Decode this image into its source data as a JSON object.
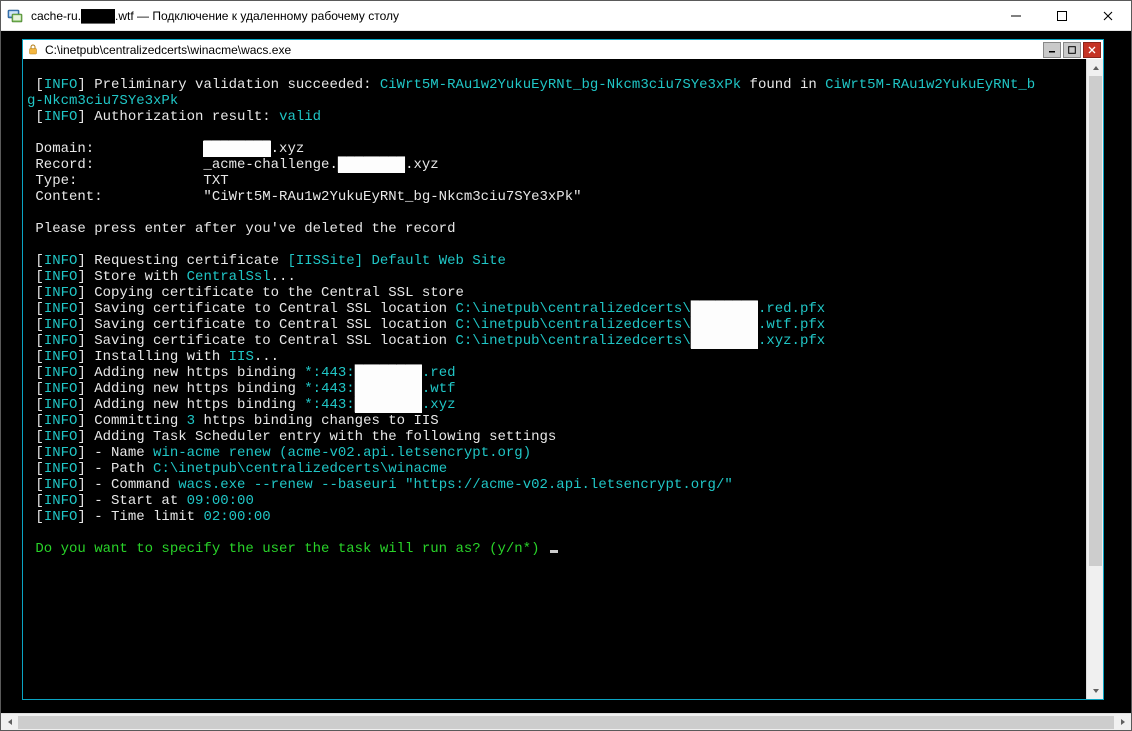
{
  "outer": {
    "title": "cache-ru.████.wtf — Подключение к удаленному рабочему столу",
    "min_tip": "Minimize",
    "max_tip": "Maximize",
    "close_tip": "Close"
  },
  "console": {
    "title": "C:\\inetpub\\centralizedcerts\\winacme\\wacs.exe"
  },
  "redacted": "████████",
  "lines": {
    "l01a": "[",
    "l01b": "INFO",
    "l01c": "] Preliminary validation succeeded: ",
    "l01d": "CiWrt5M-RAu1w2YukuEyRNt_bg-Nkcm3ciu7SYe3xPk",
    "l01e": " found in ",
    "l01f": "CiWrt5M-RAu1w2YukuEyRNt_b",
    "l02": "g-Nkcm3ciu7SYe3xPk",
    "l03a": "[",
    "l03b": "INFO",
    "l03c": "] Authorization result: ",
    "l03d": "valid",
    "l05a": " Domain:             ",
    "l05b": ".xyz",
    "l06a": " Record:             _acme-challenge.",
    "l06b": ".xyz",
    "l07": " Type:               TXT",
    "l08": " Content:            \"CiWrt5M-RAu1w2YukuEyRNt_bg-Nkcm3ciu7SYe3xPk\"",
    "l10": " Please press enter after you've deleted the record",
    "l12a": "[",
    "l12b": "INFO",
    "l12c": "] Requesting certificate ",
    "l12d": "[IISSite] Default Web Site",
    "l13a": "[",
    "l13b": "INFO",
    "l13c": "] Store with ",
    "l13d": "CentralSsl",
    "l13e": "...",
    "l14a": "[",
    "l14b": "INFO",
    "l14c": "] Copying certificate to the Central SSL store",
    "l15a": "[",
    "l15b": "INFO",
    "l15c": "] Saving certificate to Central SSL location ",
    "l15d": "C:\\inetpub\\centralizedcerts\\",
    "l15e": ".red.pfx",
    "l16a": "[",
    "l16b": "INFO",
    "l16c": "] Saving certificate to Central SSL location ",
    "l16d": "C:\\inetpub\\centralizedcerts\\",
    "l16e": ".wtf.pfx",
    "l17a": "[",
    "l17b": "INFO",
    "l17c": "] Saving certificate to Central SSL location ",
    "l17d": "C:\\inetpub\\centralizedcerts\\",
    "l17e": ".xyz.pfx",
    "l18a": "[",
    "l18b": "INFO",
    "l18c": "] Installing with ",
    "l18d": "IIS",
    "l18e": "...",
    "l19a": "[",
    "l19b": "INFO",
    "l19c": "] Adding new https binding ",
    "l19d": "*:443:",
    "l19e": ".red",
    "l20a": "[",
    "l20b": "INFO",
    "l20c": "] Adding new https binding ",
    "l20d": "*:443:",
    "l20e": ".wtf",
    "l21a": "[",
    "l21b": "INFO",
    "l21c": "] Adding new https binding ",
    "l21d": "*:443:",
    "l21e": ".xyz",
    "l22a": "[",
    "l22b": "INFO",
    "l22c": "] Committing ",
    "l22d": "3",
    "l22e": " https binding changes to IIS",
    "l23a": "[",
    "l23b": "INFO",
    "l23c": "] Adding Task Scheduler entry with the following settings",
    "l24a": "[",
    "l24b": "INFO",
    "l24c": "] - Name ",
    "l24d": "win-acme renew (acme-v02.api.letsencrypt.org)",
    "l25a": "[",
    "l25b": "INFO",
    "l25c": "] - Path ",
    "l25d": "C:\\inetpub\\centralizedcerts\\winacme",
    "l26a": "[",
    "l26b": "INFO",
    "l26c": "] - Command ",
    "l26d": "wacs.exe --renew --baseuri \"https://acme-v02.api.letsencrypt.org/\"",
    "l27a": "[",
    "l27b": "INFO",
    "l27c": "] - Start at ",
    "l27d": "09:00:00",
    "l28a": "[",
    "l28b": "INFO",
    "l28c": "] - Time limit ",
    "l28d": "02:00:00",
    "prompt": " Do you want to specify the user the task will run as? (y/n*) "
  }
}
